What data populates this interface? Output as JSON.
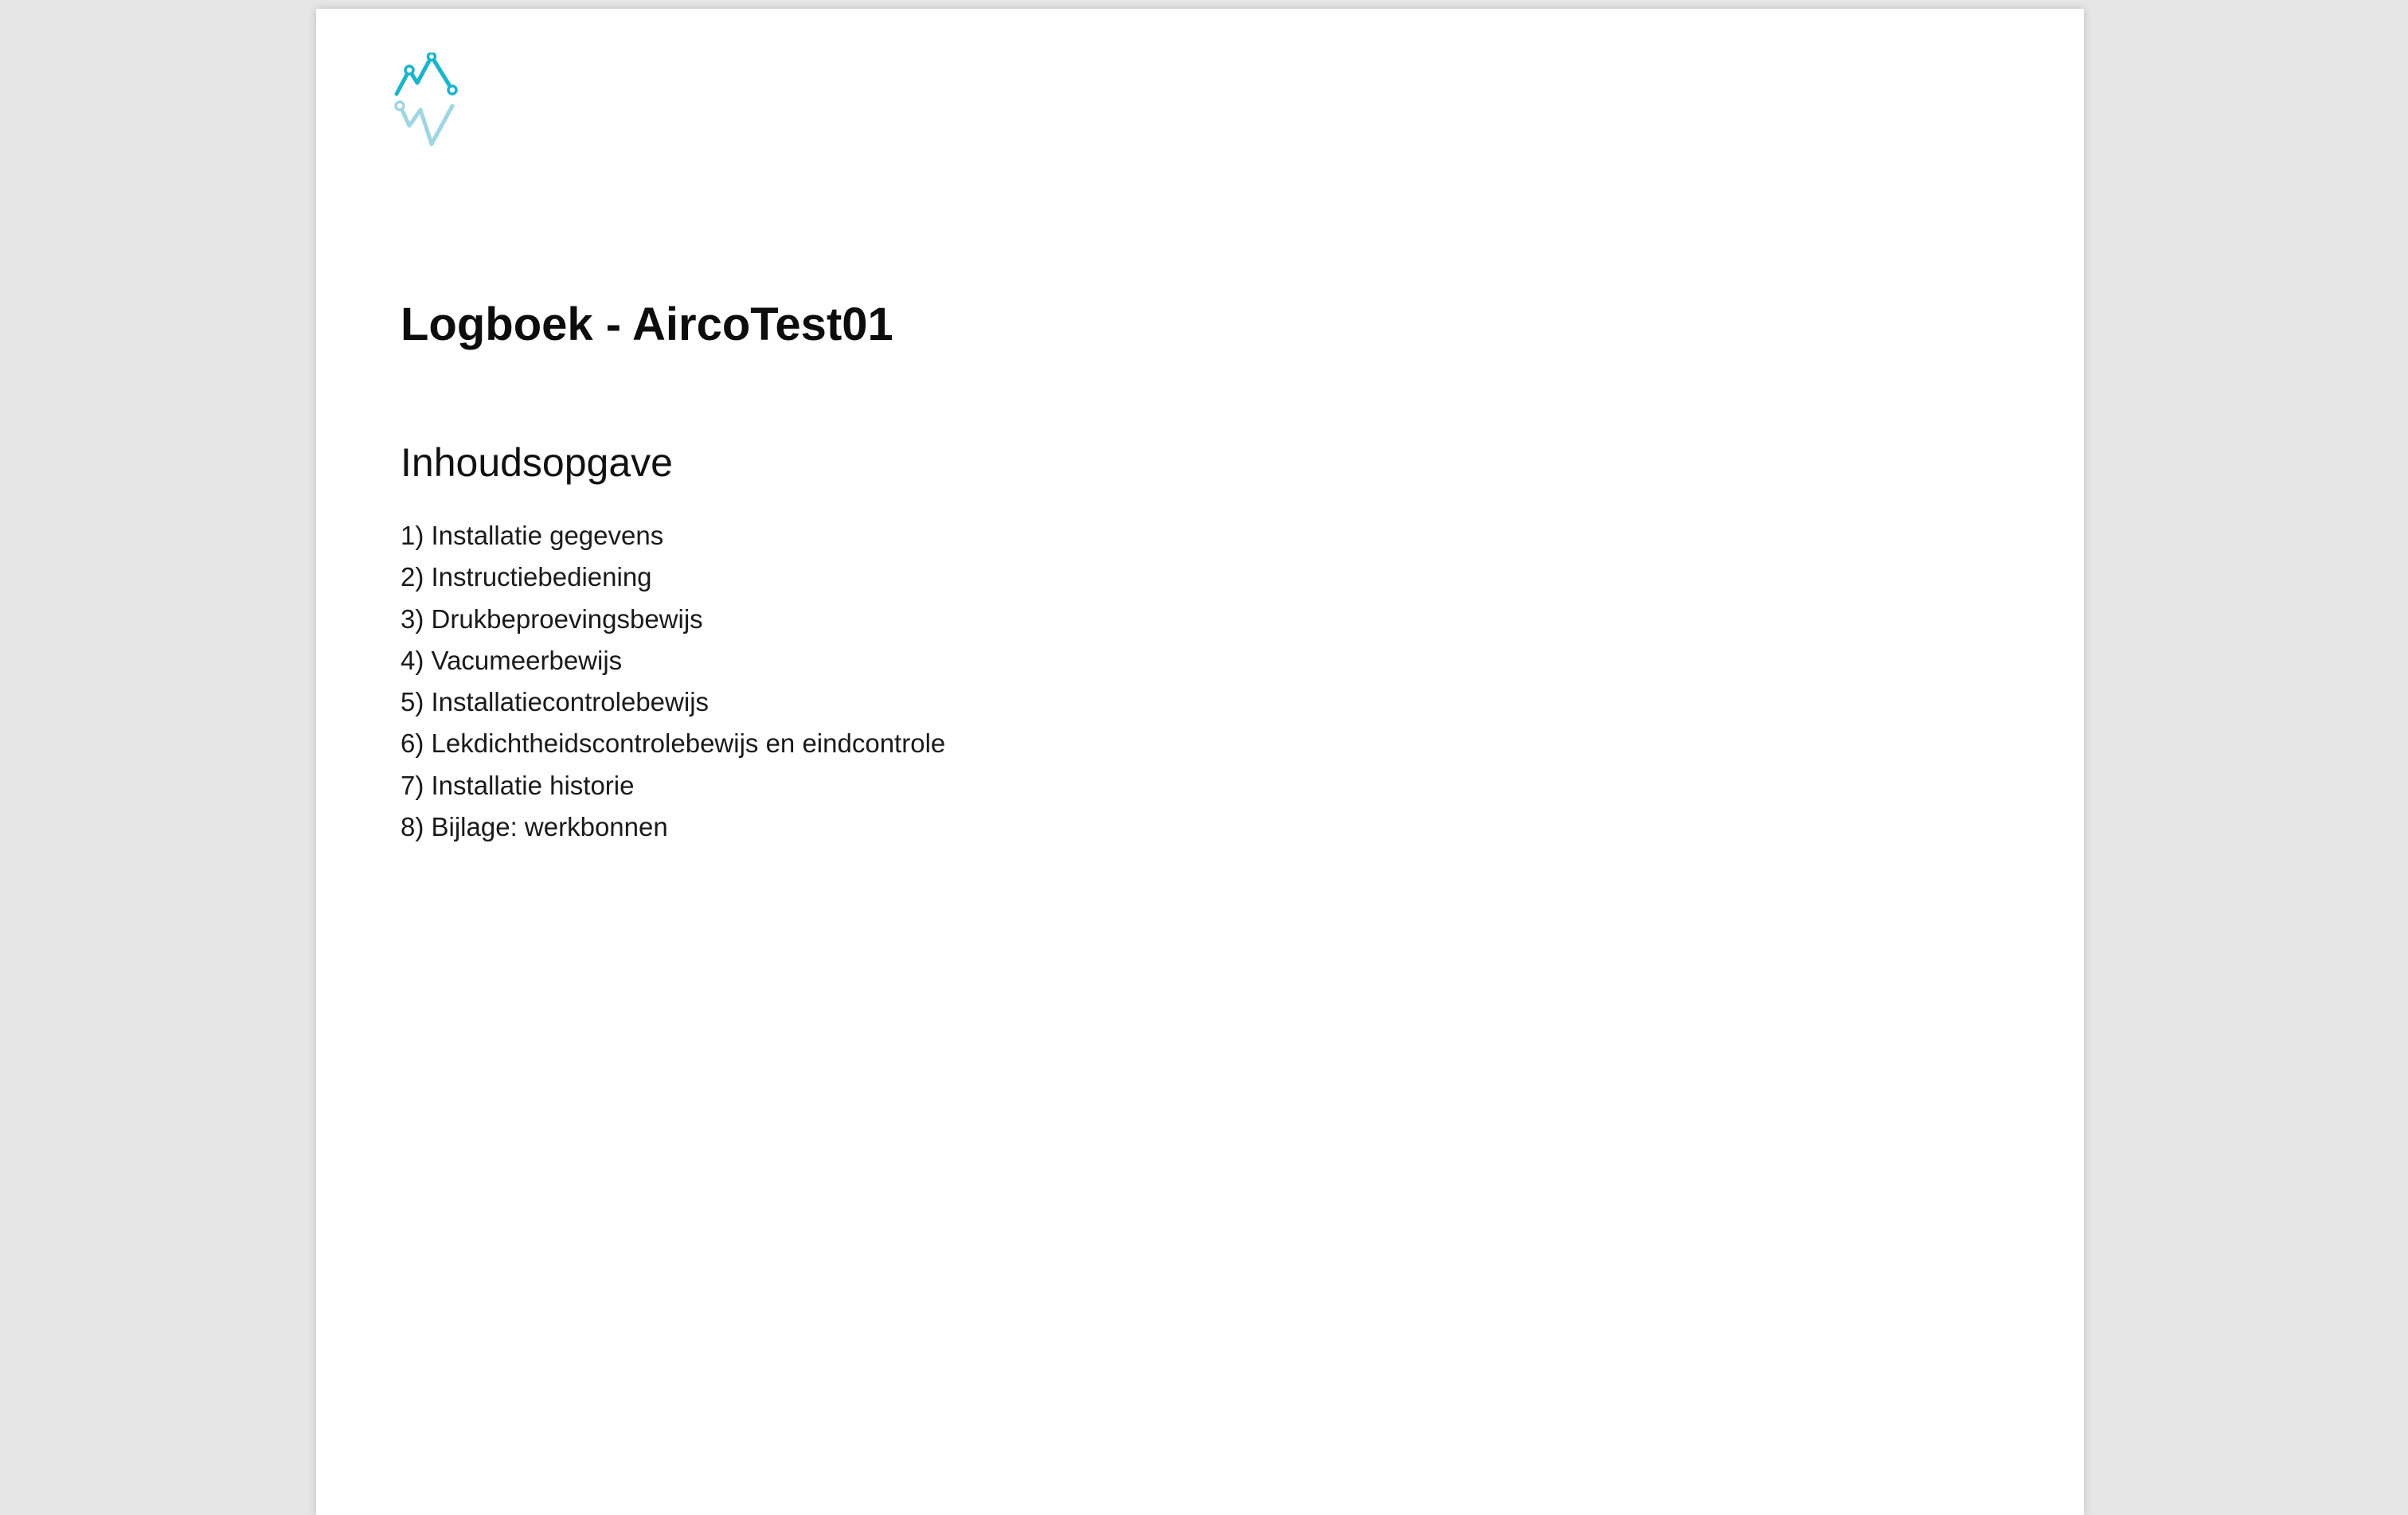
{
  "document": {
    "title": "Logboek - AircoTest01",
    "toc_heading": "Inhoudsopgave",
    "toc_items": [
      "1) Installatie gegevens",
      "2) Instructiebediening",
      "3) Drukbeproevingsbewijs",
      "4) Vacumeerbewijs",
      "5) Installatiecontrolebewijs",
      "6) Lekdichtheidscontrolebewijs en eindcontrole",
      "7) Installatie historie",
      "8) Bijlage: werkbonnen"
    ]
  },
  "colors": {
    "logo_primary": "#1ab5cc",
    "logo_light": "#9fd6e3",
    "background": "#e6e6e6",
    "page": "#ffffff"
  }
}
